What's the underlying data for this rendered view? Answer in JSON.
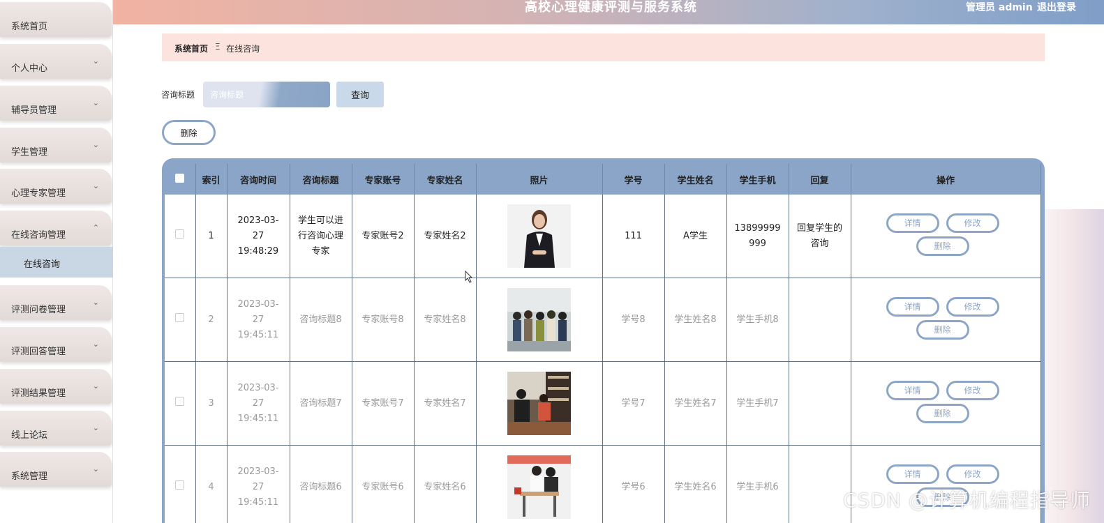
{
  "header": {
    "title": "高校心理健康评测与服务系统",
    "admin": "管理员 admin",
    "logout": "退出登录"
  },
  "sidebar": {
    "items": [
      {
        "label": "系统首页",
        "chevron": ""
      },
      {
        "label": "个人中心",
        "chevron": "⌄"
      },
      {
        "label": "辅导员管理",
        "chevron": "⌄"
      },
      {
        "label": "学生管理",
        "chevron": "⌄"
      },
      {
        "label": "心理专家管理",
        "chevron": "⌄"
      },
      {
        "label": "在线咨询管理",
        "chevron": "⌃"
      },
      {
        "label": "评测问卷管理",
        "chevron": "⌄"
      },
      {
        "label": "评测回答管理",
        "chevron": "⌄"
      },
      {
        "label": "评测结果管理",
        "chevron": "⌄"
      },
      {
        "label": "线上论坛",
        "chevron": "⌄"
      },
      {
        "label": "系统管理",
        "chevron": "⌄"
      }
    ],
    "sub_item": "在线咨询"
  },
  "breadcrumb": {
    "home": "系统首页",
    "separator": "Ξ",
    "current": "在线咨询"
  },
  "search": {
    "label": "咨询标题",
    "placeholder": "咨询标题",
    "button": "查询"
  },
  "actions": {
    "delete": "删除"
  },
  "table": {
    "headers": [
      "索引",
      "咨询时间",
      "咨询标题",
      "专家账号",
      "专家姓名",
      "照片",
      "学号",
      "学生姓名",
      "学生手机",
      "回复",
      "操作"
    ],
    "buttons": {
      "detail": "详情",
      "edit": "修改",
      "delete": "删除"
    },
    "rows": [
      {
        "index": "1",
        "time": "2023-03-27 19:48:29",
        "title": "学生可以进行咨询心理专家",
        "expert_account": "专家账号2",
        "expert_name": "专家姓名2",
        "student_no": "111",
        "student_name": "A学生",
        "phone": "13899999999",
        "reply": "回复学生的咨询"
      },
      {
        "index": "2",
        "time": "2023-03-27 19:45:11",
        "title": "咨询标题8",
        "expert_account": "专家账号8",
        "expert_name": "专家姓名8",
        "student_no": "学号8",
        "student_name": "学生姓名8",
        "phone": "学生手机8",
        "reply": ""
      },
      {
        "index": "3",
        "time": "2023-03-27 19:45:11",
        "title": "咨询标题7",
        "expert_account": "专家账号7",
        "expert_name": "专家姓名7",
        "student_no": "学号7",
        "student_name": "学生姓名7",
        "phone": "学生手机7",
        "reply": ""
      },
      {
        "index": "4",
        "time": "2023-03-27 19:45:11",
        "title": "咨询标题6",
        "expert_account": "专家账号6",
        "expert_name": "专家姓名6",
        "student_no": "学号6",
        "student_name": "学生姓名6",
        "phone": "学生手机6",
        "reply": ""
      }
    ]
  },
  "watermark": "CSDN @计算机编程指导师",
  "colors": {
    "accent": "#8aa5c8",
    "breadcrumb_bg": "#fde3dd",
    "sidebar_active": "#c9d6e3"
  }
}
